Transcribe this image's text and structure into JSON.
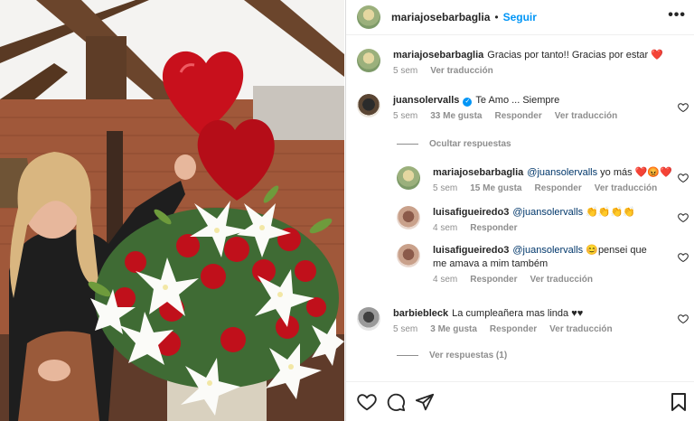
{
  "post": {
    "author": "mariajosebarbaglia",
    "separator": "•",
    "follow_label": "Seguir",
    "more_icon": "more-horizontal-icon",
    "image_alt": "Woman smiling next to a large bouquet of red roses and white lilies with heart balloons"
  },
  "caption": {
    "username": "mariajosebarbaglia",
    "text": "Gracias por tanto!! Gracias por estar ",
    "emoji": "❤️",
    "time": "5 sem",
    "translate": "Ver traducción"
  },
  "comments": [
    {
      "username": "juansolervalls",
      "verified": true,
      "text": "Te Amo ... Siempre",
      "time": "5 sem",
      "likes": "33 Me gusta",
      "reply": "Responder",
      "translate": "Ver traducción"
    },
    {
      "username": "barbiebleck",
      "text": "La cumpleañera mas linda ♥♥",
      "time": "5 sem",
      "likes": "3 Me gusta",
      "reply": "Responder",
      "translate": "Ver traducción"
    }
  ],
  "replies_toggle": {
    "hide": "Ocultar respuestas",
    "view": "Ver respuestas (1)"
  },
  "replies": [
    {
      "username": "mariajosebarbaglia",
      "mention": "@juansolervalls",
      "text": " yo más ",
      "emoji": "❤️😡❤️",
      "time": "5 sem",
      "likes": "15 Me gusta",
      "reply": "Responder",
      "translate": "Ver traducción"
    },
    {
      "username": "luisafigueiredo3",
      "mention": "@juansolervalls",
      "text": " ",
      "emoji": "👏👏👏👏",
      "time": "4 sem",
      "reply": "Responder"
    },
    {
      "username": "luisafigueiredo3",
      "mention": "@juansolervalls",
      "text": " ",
      "emoji": "😊",
      "text2": "pensei que me amava a mim também",
      "time": "4 sem",
      "reply": "Responder",
      "translate": "Ver traducción"
    }
  ],
  "colors": {
    "accent": "#0095f6",
    "muted": "#8e8e8e",
    "heart": "#ed4956"
  }
}
